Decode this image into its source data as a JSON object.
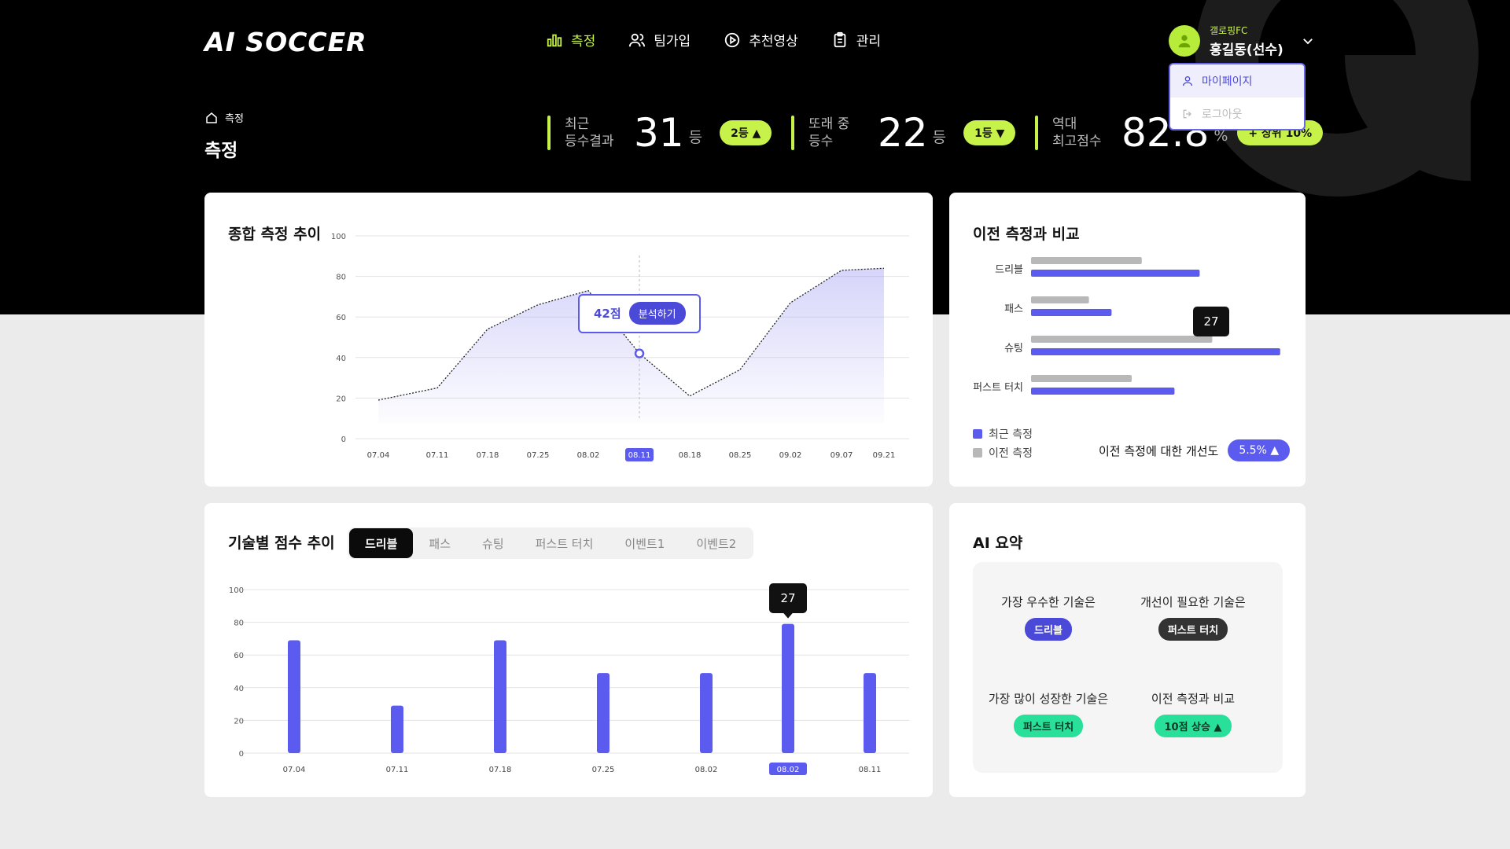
{
  "brand": {
    "logo": "AI SOCCER",
    "accent": "#c7f24a",
    "primary": "#5b5bef"
  },
  "nav": [
    {
      "label": "측정",
      "icon": "bar-chart-icon",
      "active": true
    },
    {
      "label": "팀가입",
      "icon": "users-icon",
      "active": false
    },
    {
      "label": "추천영상",
      "icon": "play-circle-icon",
      "active": false
    },
    {
      "label": "관리",
      "icon": "clipboard-icon",
      "active": false
    }
  ],
  "user": {
    "team": "갤로핑FC",
    "name": "홍길동(선수)"
  },
  "dropdown": {
    "mypage": "마이페이지",
    "logout": "로그아웃"
  },
  "breadcrumb": {
    "label": "측정"
  },
  "page": {
    "title": "측정"
  },
  "stats": [
    {
      "label_line1": "최근",
      "label_line2": "등수결과",
      "value": "31",
      "unit": "등",
      "chip": "2등"
    },
    {
      "label_line1": "또래 중",
      "label_line2": "등수",
      "value": "22",
      "unit": "등",
      "chip": "1등"
    },
    {
      "label_line1": "역대",
      "label_line2": "최고점수",
      "value": "82.8",
      "unit": "%",
      "chip": "+ 상위 10%"
    }
  ],
  "overall": {
    "title": "종합 측정 추이",
    "tooltip": {
      "score": "42점",
      "button": "분석하기"
    },
    "chart_data": {
      "type": "area",
      "x": [
        "07.04",
        "07.11",
        "07.18",
        "07.25",
        "08.02",
        "08.11",
        "08.18",
        "08.25",
        "09.02",
        "09.07",
        "09.21"
      ],
      "values": [
        19,
        25,
        54,
        66,
        73,
        42,
        21,
        34,
        67,
        83,
        84
      ],
      "ylim": [
        0,
        100
      ],
      "yticks": [
        0,
        20,
        40,
        60,
        80,
        100
      ],
      "highlight_index": 5
    }
  },
  "compare": {
    "title": "이전 측정과 비교",
    "tooltip": "27",
    "chart_data": {
      "type": "bar",
      "categories": [
        "드리블",
        "패스",
        "슈팅",
        "퍼스트 터치"
      ],
      "series": [
        {
          "name": "최근 측정",
          "color": "#5b5bef",
          "values": [
            67,
            32,
            99,
            57
          ]
        },
        {
          "name": "이전 측정",
          "color": "#b8b8b8",
          "values": [
            44,
            23,
            72,
            40
          ]
        }
      ],
      "xlim": [
        0,
        100
      ]
    },
    "legend_recent": "최근 측정",
    "legend_prev": "이전 측정",
    "improvement_label": "이전 측정에 대한 개선도",
    "improvement_value": "5.5%"
  },
  "skills": {
    "title": "기술별 점수 추이",
    "tabs": [
      "드리블",
      "패스",
      "슈팅",
      "퍼스트 터치",
      "이벤트1",
      "이벤트2"
    ],
    "tooltip": "27",
    "chart_data": {
      "type": "bar",
      "categories": [
        "07.04",
        "07.11",
        "07.18",
        "07.25",
        "08.02",
        "08.02",
        "08.11"
      ],
      "values": [
        69,
        29,
        69,
        49,
        49,
        79,
        49
      ],
      "ylim": [
        0,
        100
      ],
      "yticks": [
        0,
        20,
        40,
        60,
        80,
        100
      ],
      "highlight_index": 5
    }
  },
  "ai": {
    "title": "AI 요약",
    "best": {
      "label": "가장 우수한 기술은",
      "value": "드리블"
    },
    "needs": {
      "label": "개선이 필요한 기술은",
      "value": "퍼스트 터치"
    },
    "growth": {
      "label": "가장 많이 성장한 기술은",
      "value": "퍼스트 터치"
    },
    "prev": {
      "label": "이전 측정과 비교",
      "value": "10점 상승"
    }
  }
}
